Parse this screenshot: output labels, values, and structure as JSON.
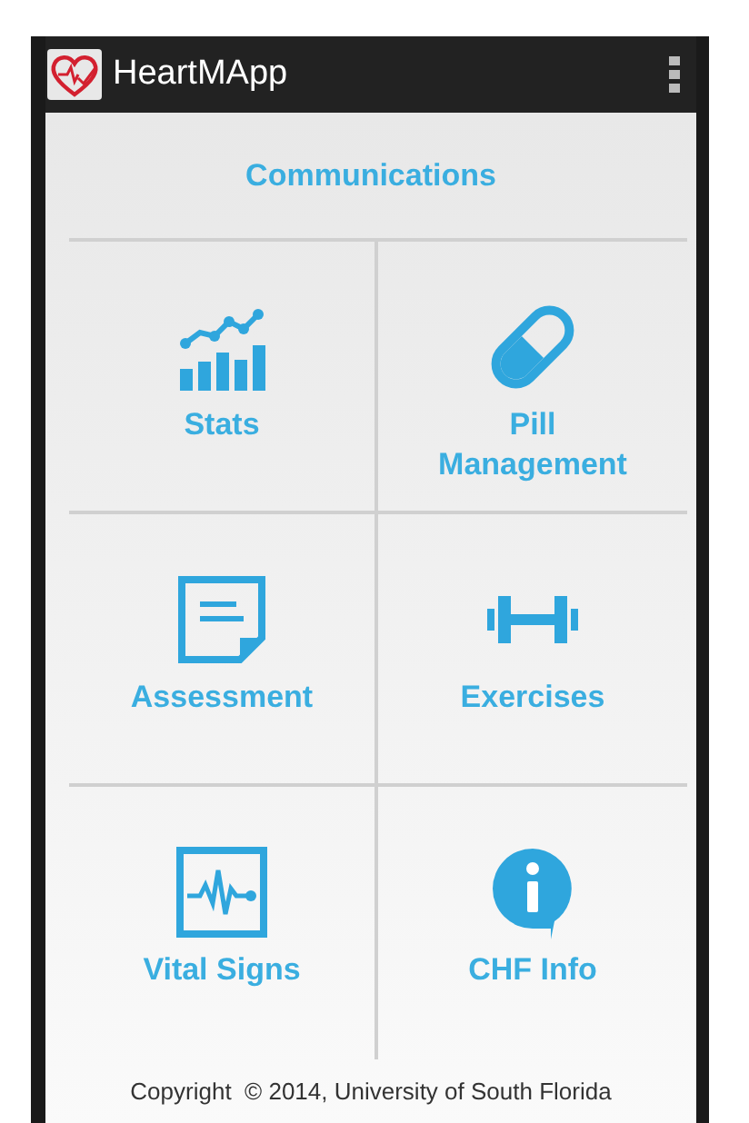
{
  "app_bar": {
    "title": "HeartMApp"
  },
  "section_title": "Communications",
  "tiles": [
    {
      "kind": "stats",
      "label": "Stats"
    },
    {
      "kind": "pill",
      "label": "Pill Management"
    },
    {
      "kind": "assessment",
      "label": "Assessment"
    },
    {
      "kind": "exercises",
      "label": "Exercises"
    },
    {
      "kind": "vitals",
      "label": "Vital Signs"
    },
    {
      "kind": "info",
      "label": "CHF Info"
    }
  ],
  "footer": "Copyright  © 2014, University of South Florida"
}
